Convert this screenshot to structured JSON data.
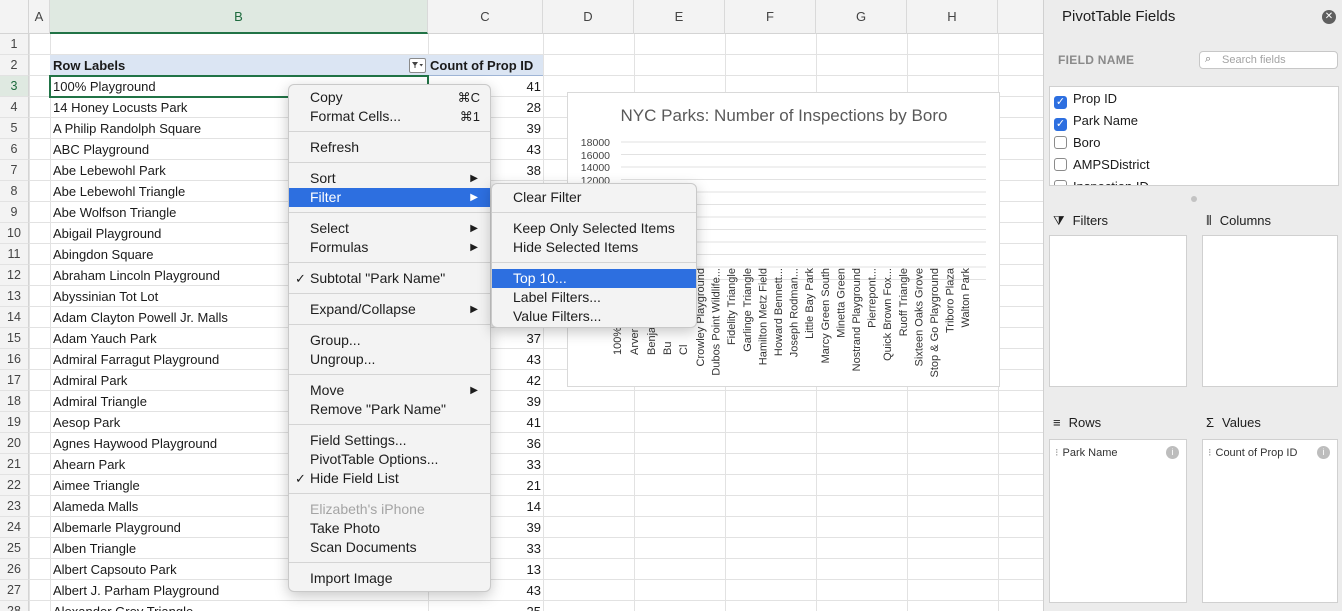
{
  "sheet": {
    "columns": [
      "A",
      "B",
      "C",
      "D",
      "E",
      "F",
      "G",
      "H"
    ],
    "row_numbers": [
      "1",
      "2",
      "3",
      "4",
      "5",
      "6",
      "7",
      "8",
      "9",
      "10",
      "11",
      "12",
      "13",
      "14",
      "15",
      "16",
      "17",
      "18",
      "19",
      "20",
      "21",
      "22",
      "23",
      "24",
      "25",
      "26",
      "27",
      "28"
    ],
    "header_row_label": "Row Labels",
    "header_count_label": "Count of Prop ID",
    "rows": [
      {
        "name": "100% Playground",
        "count": "41"
      },
      {
        "name": "14 Honey Locusts Park",
        "count": "28"
      },
      {
        "name": "A Philip Randolph Square",
        "count": "39"
      },
      {
        "name": "ABC Playground",
        "count": "43"
      },
      {
        "name": "Abe Lebewohl Park",
        "count": "38"
      },
      {
        "name": "Abe Lebewohl Triangle",
        "count": ""
      },
      {
        "name": "Abe Wolfson Triangle",
        "count": ""
      },
      {
        "name": "Abigail Playground",
        "count": ""
      },
      {
        "name": "Abingdon Square",
        "count": ""
      },
      {
        "name": "Abraham Lincoln Playground",
        "count": ""
      },
      {
        "name": "Abyssinian Tot Lot",
        "count": ""
      },
      {
        "name": "Adam Clayton Powell Jr. Malls",
        "count": ""
      },
      {
        "name": "Adam Yauch Park",
        "count": "37"
      },
      {
        "name": "Admiral Farragut Playground",
        "count": "43"
      },
      {
        "name": "Admiral Park",
        "count": "42"
      },
      {
        "name": "Admiral Triangle",
        "count": "39"
      },
      {
        "name": "Aesop Park",
        "count": "41"
      },
      {
        "name": "Agnes Haywood Playground",
        "count": "36"
      },
      {
        "name": "Ahearn Park",
        "count": "33"
      },
      {
        "name": "Aimee Triangle",
        "count": "21"
      },
      {
        "name": "Alameda Malls",
        "count": "14"
      },
      {
        "name": "Albemarle Playground",
        "count": "39"
      },
      {
        "name": "Alben Triangle",
        "count": "33"
      },
      {
        "name": "Albert Capsouto Park",
        "count": "13"
      },
      {
        "name": "Albert J. Parham Playground",
        "count": "43"
      },
      {
        "name": "Alexander Grey Triangle",
        "count": "25"
      }
    ]
  },
  "chart": {
    "title": "NYC Parks: Number of Inspections by Boro",
    "y_ticks": [
      "18000",
      "16000",
      "14000",
      "12000"
    ],
    "x_labels_partial": [
      "100%",
      "Arvern",
      "Benjam",
      "Bu",
      "Cl"
    ],
    "x_labels": [
      "Crowley Playground",
      "Dubos Point Wildlife...",
      "Fidelity Triangle",
      "Garlinge Triangle",
      "Hamilton Metz Field",
      "Howard Bennett...",
      "Joseph Rodman...",
      "Little Bay Park",
      "Marcy Green South",
      "Minetta Green",
      "Nostrand Playground",
      "Pierrepont...",
      "Quick Brown Fox...",
      "Ruoff Triangle",
      "Sixteen Oaks Grove",
      "Stop & Go Playground",
      "Triboro Plaza",
      "Walton Park"
    ]
  },
  "context_menu": {
    "copy": "Copy",
    "copy_sc": "⌘C",
    "format_cells": "Format Cells...",
    "format_sc": "⌘1",
    "refresh": "Refresh",
    "sort": "Sort",
    "filter": "Filter",
    "select": "Select",
    "formulas": "Formulas",
    "subtotal": "Subtotal \"Park Name\"",
    "expand_collapse": "Expand/Collapse",
    "group": "Group...",
    "ungroup": "Ungroup...",
    "move": "Move",
    "remove": "Remove \"Park Name\"",
    "field_settings": "Field Settings...",
    "pivot_options": "PivotTable Options...",
    "hide_field_list": "Hide Field List",
    "iphone": "Elizabeth's iPhone",
    "take_photo": "Take Photo",
    "scan_documents": "Scan Documents",
    "import_image": "Import Image",
    "check_mark": "✓",
    "submenu_arrow": "▶"
  },
  "filter_submenu": {
    "clear_filter": "Clear Filter",
    "keep_only": "Keep Only Selected Items",
    "hide_selected": "Hide Selected Items",
    "top10": "Top 10...",
    "label_filters": "Label Filters...",
    "value_filters": "Value Filters..."
  },
  "panel": {
    "title": "PivotTable Fields",
    "field_name_label": "FIELD NAME",
    "search_placeholder": "Search fields",
    "fields": [
      {
        "label": "Prop ID",
        "checked": true
      },
      {
        "label": "Park Name",
        "checked": true
      },
      {
        "label": "Boro",
        "checked": false
      },
      {
        "label": "AMPSDistrict",
        "checked": false
      },
      {
        "label": "Inspection ID",
        "checked": false
      }
    ],
    "filters_label": "Filters",
    "columns_label": "Columns",
    "rows_label": "Rows",
    "values_label": "Values",
    "rows_chip": "Park Name",
    "values_chip": "Count of Prop ID",
    "info_glyph": "i",
    "grip_glyph": "⁝",
    "close_glyph": "✕",
    "search_glyph": "⌕",
    "filter_glyph": "⧩",
    "columns_glyph": "⦀",
    "rows_glyph": "≡",
    "values_glyph": "Σ"
  },
  "colors": {
    "accent": "#217346",
    "highlight": "#2d6fe0",
    "chart_title": "#595959"
  }
}
